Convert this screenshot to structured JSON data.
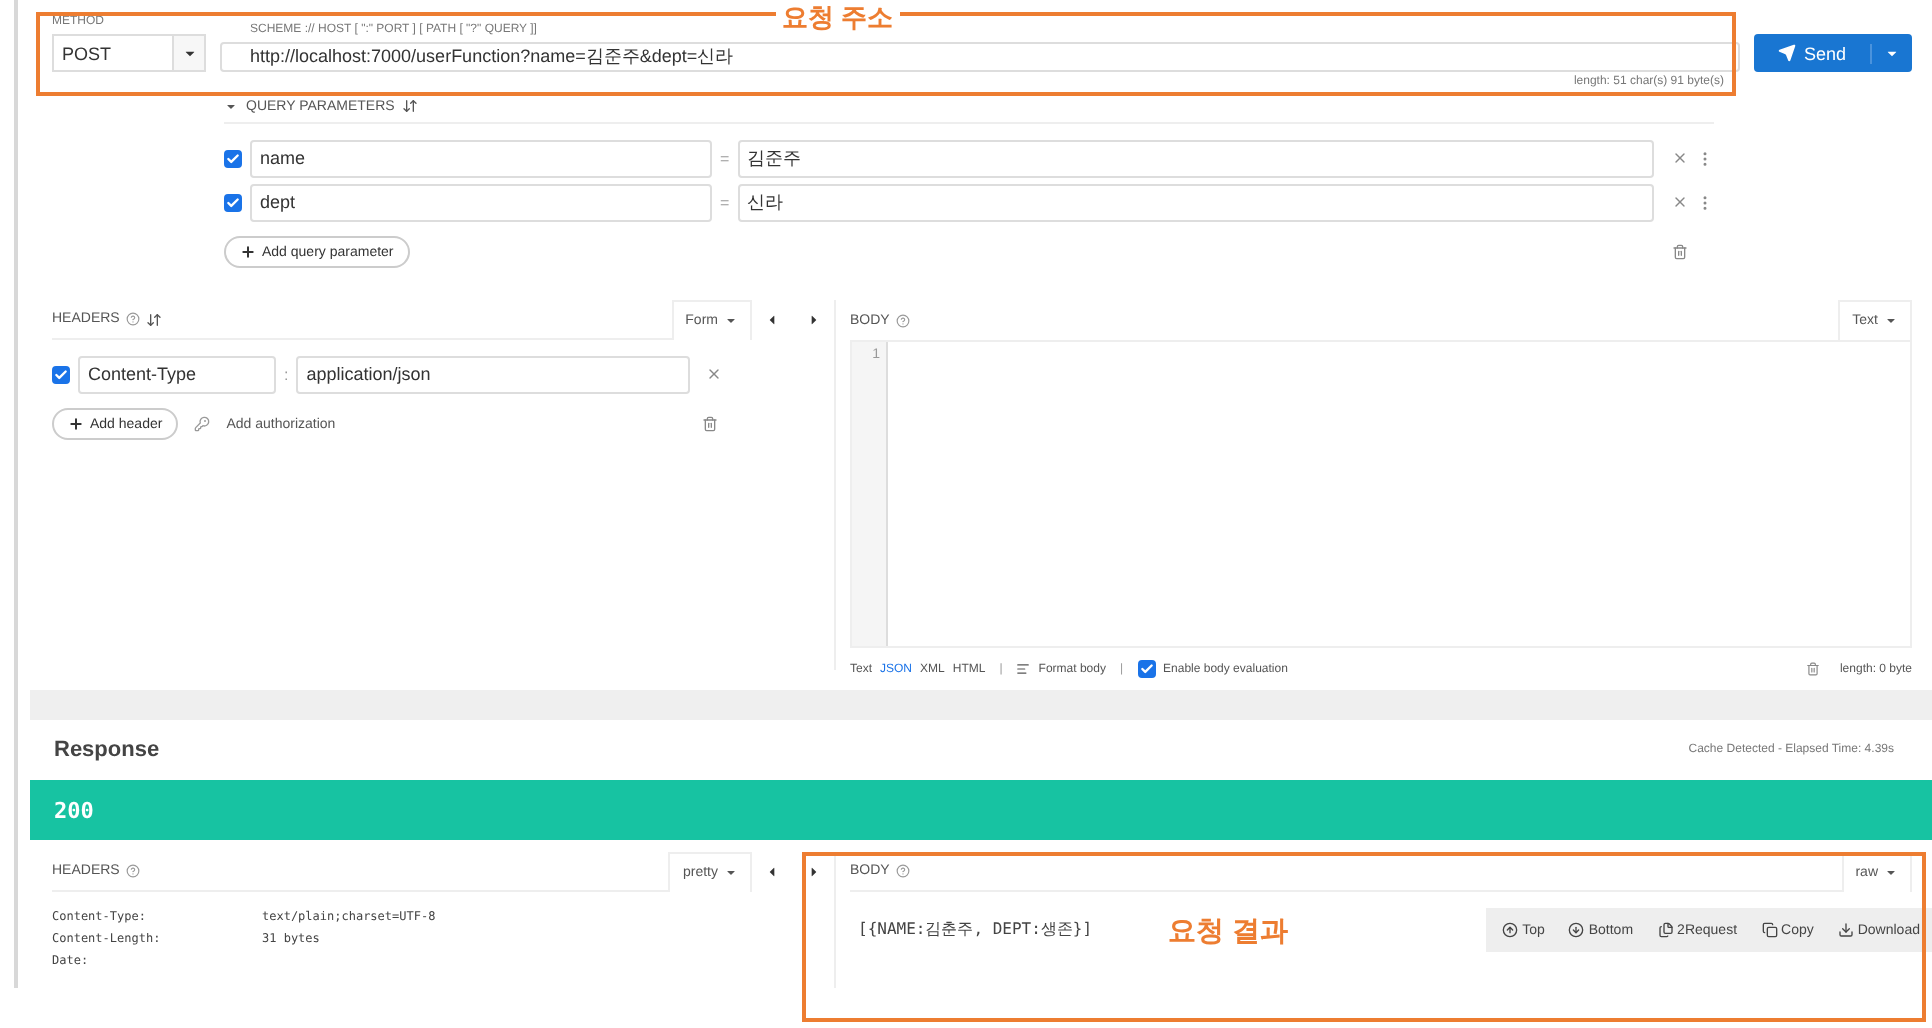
{
  "request": {
    "method_label": "METHOD",
    "method": "POST",
    "url_label": "SCHEME :// HOST [ \":\" PORT ] [ PATH [ \"?\" QUERY ]]",
    "url": "http://localhost:7000/userFunction?name=김준주&dept=신라",
    "length": "length: 51 char(s) 91 byte(s)",
    "send": "Send"
  },
  "query_parameters": {
    "title": "QUERY PARAMETERS",
    "expanded": true,
    "items": [
      {
        "name": "name",
        "separator": "=",
        "value": "김준주",
        "enabled": true
      },
      {
        "name": "dept",
        "separator": "=",
        "value": "신라",
        "enabled": true
      }
    ],
    "add": "Add query parameter"
  },
  "headers": {
    "title": "HEADERS",
    "mode": "Form",
    "items": [
      {
        "name": "Content-Type",
        "separator": ":",
        "value": "application/json",
        "enabled": true
      }
    ],
    "add": "Add header",
    "auth": "Add authorization"
  },
  "body": {
    "title": "BODY",
    "mode": "Text",
    "line_numbers": [
      "1"
    ],
    "formats": [
      {
        "label": "Text",
        "selected": false
      },
      {
        "label": "JSON",
        "selected": true
      },
      {
        "label": "XML",
        "selected": false
      },
      {
        "label": "HTML",
        "selected": false
      }
    ],
    "dividers": [
      "|",
      "|"
    ],
    "format_body": "Format body",
    "evaluation": {
      "label": "Enable body evaluation",
      "checked": true
    },
    "length": "length: 0 byte"
  },
  "response": {
    "title": "Response",
    "timing": "Cache Detected - Elapsed Time: 4.39s",
    "status": "200",
    "headers": {
      "title": "HEADERS",
      "mode": "pretty",
      "items": [
        {
          "name": "Content-Type:",
          "value": "text/plain;charset=UTF-8"
        },
        {
          "name": "Content-Length:",
          "value": "31 bytes"
        },
        {
          "name": "Date:",
          "value": ""
        }
      ]
    },
    "body": {
      "title": "BODY",
      "mode": "raw",
      "content": "[{NAME:김춘주, DEPT:생존}]",
      "actions": [
        {
          "kind": "top",
          "label": "Top"
        },
        {
          "kind": "bottom",
          "label": "Bottom"
        },
        {
          "kind": "request",
          "label": "2Request"
        },
        {
          "kind": "copy",
          "label": "Copy"
        },
        {
          "kind": "download",
          "label": "Download"
        }
      ]
    }
  },
  "annotations": [
    {
      "label": "요청 주소"
    },
    {
      "label": "요청 결과"
    }
  ]
}
